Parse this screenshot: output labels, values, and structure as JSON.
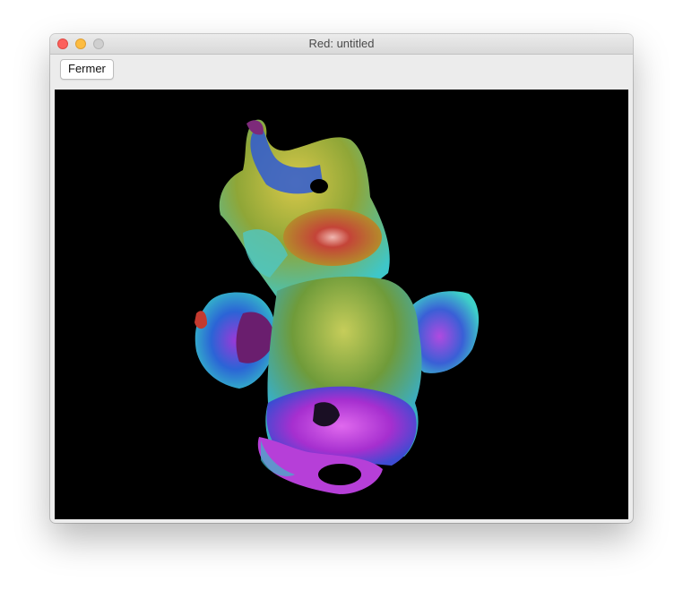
{
  "window": {
    "title": "Red: untitled"
  },
  "toolbar": {
    "close_label": "Fermer"
  },
  "viewport": {
    "background_color": "#000000",
    "content": "color-mapped-3d-surface"
  },
  "colors": {
    "close_button": "#fc605c",
    "minimize_button": "#fdbc40",
    "zoom_button": "#cfcfcf"
  }
}
